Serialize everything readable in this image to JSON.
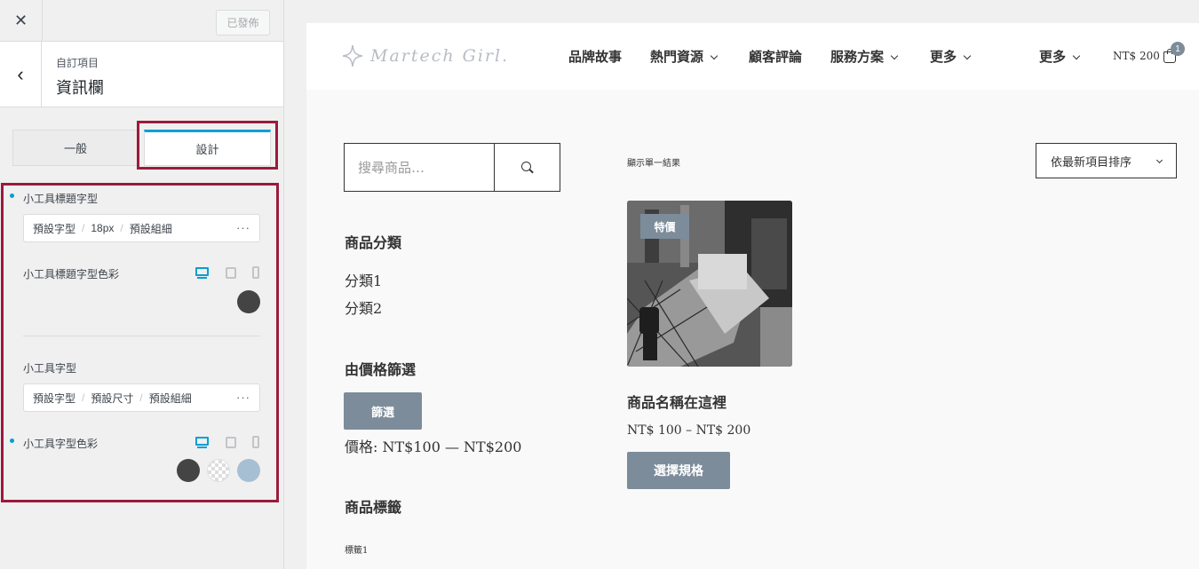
{
  "panel": {
    "close_icon": "close-icon",
    "publish_label": "已發佈",
    "breadcrumb": "自訂項目",
    "section_title": "資訊欄",
    "tabs": [
      {
        "label": "一般"
      },
      {
        "label": "設計"
      }
    ],
    "highlight_color": "#9b1b3d",
    "accent_color": "#00a0d2",
    "widget_title_font": {
      "label": "小工具標題字型",
      "family": "預設字型",
      "size": "18px",
      "weight": "預設組細",
      "more": "···"
    },
    "widget_title_color": {
      "label": "小工具標題字型色彩",
      "colors": [
        "#444444"
      ]
    },
    "widget_font": {
      "label": "小工具字型",
      "family": "預設字型",
      "size": "預設尺寸",
      "weight": "預設組細",
      "more": "···"
    },
    "widget_font_color": {
      "label": "小工具字型色彩",
      "colors": [
        "#444444",
        "transparent",
        "#a7bfd3"
      ]
    }
  },
  "preview": {
    "logo_text": "Martech Girl.",
    "nav": [
      {
        "label": "品牌故事",
        "dropdown": false
      },
      {
        "label": "熱門資源",
        "dropdown": true
      },
      {
        "label": "顧客評論",
        "dropdown": false
      },
      {
        "label": "服務方案",
        "dropdown": true
      },
      {
        "label": "更多",
        "dropdown": true
      },
      {
        "label": "更多",
        "dropdown": true
      }
    ],
    "cart_total": "NT$ 200",
    "cart_count": "1",
    "search_placeholder": "搜尋商品…",
    "categories_title": "商品分類",
    "categories": [
      "分類1",
      "分類2"
    ],
    "price_filter_title": "由價格篩選",
    "filter_button": "篩選",
    "price_range": "價格: NT$100 — NT$200",
    "tags_title": "商品標籤",
    "tags": [
      "標籤1"
    ],
    "result_count": "顯示單一結果",
    "sort_label": "依最新項目排序",
    "product": {
      "badge": "特價",
      "name": "商品名稱在這裡",
      "price": "NT$ 100 – NT$ 200",
      "button": "選擇規格"
    },
    "brand_color": "#7d8c9a"
  }
}
